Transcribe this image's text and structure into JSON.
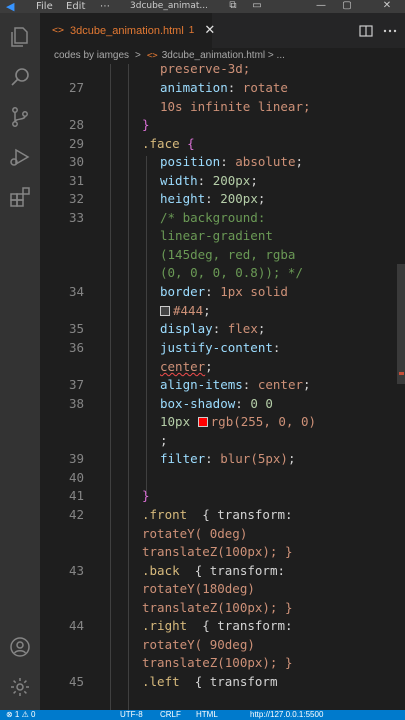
{
  "titlebar": {
    "logo": "◀",
    "menu": [
      "File",
      "Edit",
      "⋯"
    ],
    "window_title": "3dcube_animat...",
    "controls": [
      "⧉",
      "▭",
      "—",
      "▢",
      "✕"
    ]
  },
  "activity_bar": {
    "icons": [
      "explorer-icon",
      "search-icon",
      "source-control-icon",
      "run-debug-icon",
      "extensions-icon",
      "account-icon",
      "settings-gear-icon"
    ]
  },
  "tab": {
    "icon": "<>",
    "label": "3dcube_animation.html",
    "problems_count": "1",
    "close": "✕"
  },
  "breadcrumbs": {
    "folder": "codes by iamges",
    "separator": ">",
    "file_icon": "<>",
    "file": "3dcube_animation.html",
    "more": "> ..."
  },
  "editor": {
    "line_numbers": [
      "27",
      "28",
      "29",
      "30",
      "31",
      "32",
      "33",
      "34",
      "35",
      "36",
      "37",
      "38",
      "39",
      "40",
      "41",
      "42",
      "43",
      "44",
      "45"
    ],
    "top_partial_line": "preserve-3d;",
    "code": {
      "l27a_prop": "animation",
      "l27a_val": "rotate",
      "l27b": "10s infinite linear;",
      "l28": "}",
      "l29_sel": ".face",
      "l29_brace": "{",
      "l30_prop": "position",
      "l30_val": "absolute",
      "l31_prop": "width",
      "l31_val": "200px",
      "l32_prop": "height",
      "l32_val": "200px",
      "l33_c1": "/* background:",
      "l33_c2": "linear-gradient",
      "l33_c3": "(145deg, red, rgba",
      "l33_c4": "(0, 0, 0, 0.8)); */",
      "l34_prop": "border",
      "l34_val": "1px solid",
      "l34_color": "#444",
      "l35_prop": "display",
      "l35_val": "flex",
      "l36_prop": "justify-content",
      "l36_val": "center",
      "l37_prop": "align-items",
      "l37_val": "center",
      "l38_prop": "box-shadow",
      "l38_val": "0 0",
      "l38_val2": "10px",
      "l38_color": "rgb(255, 0, 0)",
      "l38_semi": ";",
      "l39_prop": "filter",
      "l39_val": "blur(5px)",
      "l41": "}",
      "l42_sel": ".front",
      "l42_rest": "{ transform:",
      "l42_b": "rotateY( 0deg)",
      "l42_c": "translateZ(100px); }",
      "l43_sel": ".back",
      "l43_rest": "{ transform:",
      "l43_b": "rotateY(180deg)",
      "l43_c": "translateZ(100px); }",
      "l44_sel": ".right",
      "l44_rest": "{ transform:",
      "l44_b": "rotateY( 90deg)",
      "l44_c": "translateZ(100px); }",
      "l45_sel": ".left",
      "l45_rest": "{ transform"
    },
    "swatch_colors": {
      "border": "#444444",
      "shadow": "#ff0000"
    }
  },
  "statusbar": {
    "errors": "⊗ 1 ⚠ 0",
    "encoding": "UTF-8",
    "eol": "CRLF",
    "language": "HTML",
    "live_server": "http://127.0.0.1:5500"
  },
  "colors": {
    "accent": "#007acc",
    "tab_modified": "#e37933",
    "property": "#9cdcfe",
    "value": "#ce9178",
    "selector": "#d7ba7d",
    "comment": "#6a9955"
  }
}
